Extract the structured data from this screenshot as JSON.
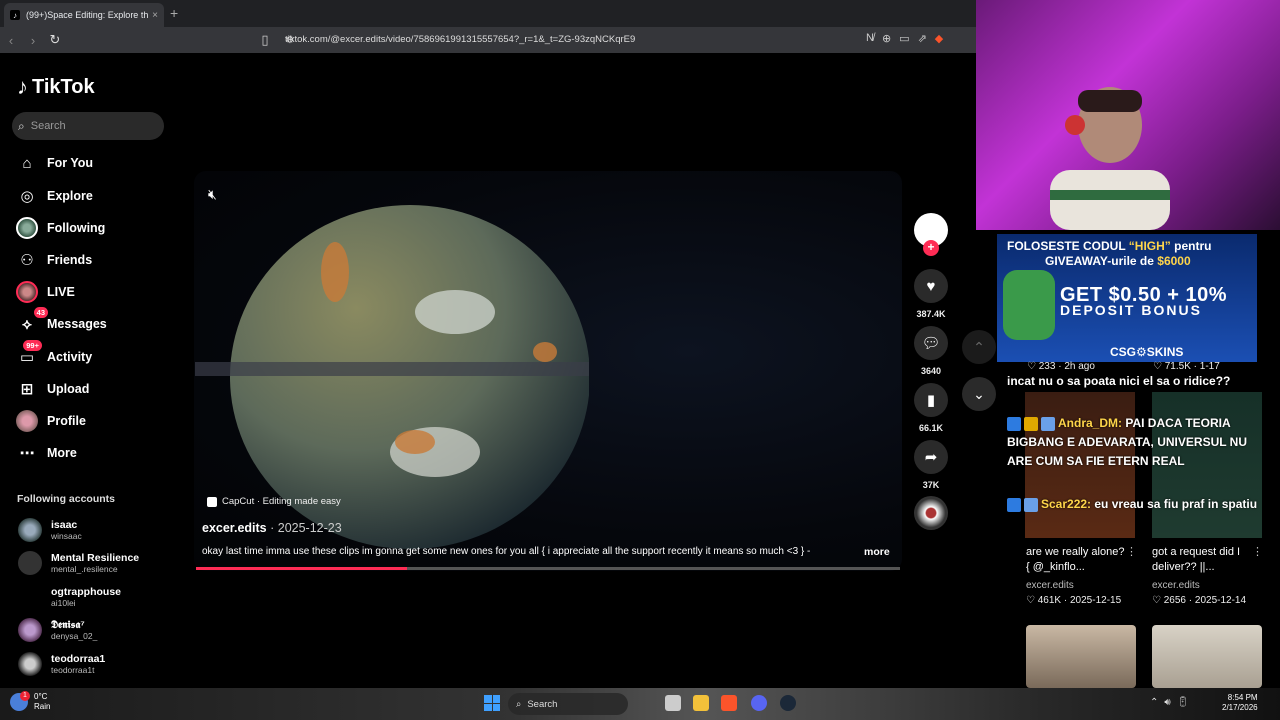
{
  "browser": {
    "tab_title": "(99+)Space Editing: Explore the",
    "tab_close": "×",
    "new_tab": "+",
    "url": "tiktok.com/@excer.edits/video/7586961991315557654?_r=1&_t=ZG-93zqNCKqrE9"
  },
  "sidebar": {
    "logo": "TikTok",
    "search_placeholder": "Search",
    "nav": [
      {
        "label": "For You",
        "icon": "home-icon"
      },
      {
        "label": "Explore",
        "icon": "compass-icon"
      },
      {
        "label": "Following",
        "icon": "following-avatar"
      },
      {
        "label": "Friends",
        "icon": "friends-icon"
      },
      {
        "label": "LIVE",
        "icon": "live-icon"
      },
      {
        "label": "Messages",
        "icon": "messages-icon",
        "badge": "43"
      },
      {
        "label": "Activity",
        "icon": "activity-icon",
        "badge": "99+"
      },
      {
        "label": "Upload",
        "icon": "upload-icon"
      },
      {
        "label": "Profile",
        "icon": "profile-avatar"
      },
      {
        "label": "More",
        "icon": "more-icon"
      }
    ],
    "following_accounts_title": "Following accounts",
    "accounts": [
      {
        "name": "isaac",
        "handle": "winsaac"
      },
      {
        "name": "Mental Resilience",
        "handle": "mental_.resilence"
      },
      {
        "name": "ogtrapphouse",
        "handle": "ai10lei"
      },
      {
        "name": "𝕯𝖊𝖓𝖎𝖘𝖆⁷",
        "handle": "denysa_02_"
      },
      {
        "name": "teodorraa1",
        "handle": "teodorraa1t"
      }
    ]
  },
  "video": {
    "capcut_label": "CapCut · Editing made easy",
    "author": "excer.edits",
    "date": " · 2025-12-23",
    "caption": "okay last time imma use these clips im gonna get some new ones for you all { i appreciate all the support recently it means so much <3 } -",
    "more": "more",
    "progress": 0.3,
    "actions": {
      "likes": "387.4K",
      "comments": "3640",
      "saves": "66.1K",
      "shares": "37K"
    }
  },
  "stream": {
    "ad": {
      "line1_a": "FOLOSESTE CODUL ",
      "line1_code": "“HIGH”",
      "line1_b": " pentru",
      "line2_a": "GIVEAWAY-urile de ",
      "line2_amount": "$6000",
      "line3": "GET $0.50 + 10%",
      "line4": "DEPOSIT BONUS",
      "logo": "CSG⚙SKINS"
    },
    "stat_left": "♡ 233 · 2h ago",
    "stat_right": "♡ 71.5K · 1-17",
    "chat1": "incat nu o sa poata nici el sa o ridice??",
    "chat2_user": "Andra_DM:",
    "chat2_text": " PAI DACA TEORIA BIGBANG E ADEVARATA, UNIVERSUL NU ARE CUM SA FIE ETERN REAL",
    "chat3_user": "Scar222:",
    "chat3_text": " eu vreau sa fiu praf in spatiu",
    "related": [
      {
        "title": "are we really alone? { @_kinflo...",
        "author": "excer.edits",
        "likes": "♡ 461K",
        "date": "2025-12-15"
      },
      {
        "title": "got a request did I deliver?? ||...",
        "author": "excer.edits",
        "likes": "♡ 2656",
        "date": "2025-12-14"
      }
    ]
  },
  "taskbar": {
    "temp": "0°C",
    "weather": "Rain",
    "weather_badge": "1",
    "search": "Search",
    "time": "8:54 PM",
    "date": "2/17/2026"
  }
}
